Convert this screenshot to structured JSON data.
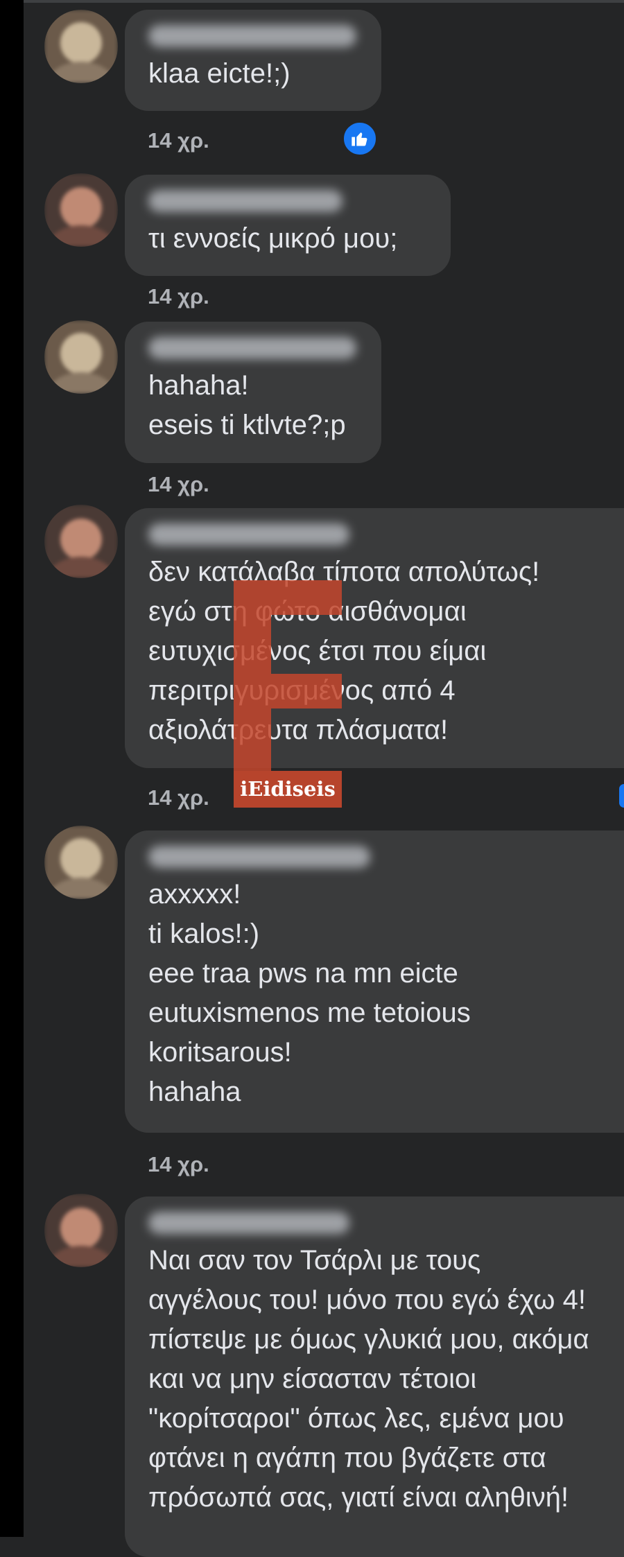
{
  "comments": [
    {
      "author_hidden": true,
      "lines": [
        "klaa eicte!;)"
      ],
      "time": "14 χρ.",
      "liked": true,
      "like_icon": "thumbs-up-icon",
      "avatar_colors": [
        "#6b5a4a",
        "#c9b79a"
      ]
    },
    {
      "author_hidden": true,
      "lines": [
        "τι εννοείς μικρό μου;"
      ],
      "time": "14 χρ.",
      "avatar_colors": [
        "#4a3a35",
        "#c08a74"
      ]
    },
    {
      "author_hidden": true,
      "lines": [
        "hahaha!",
        "eseis ti ktlvte?;p"
      ],
      "time": "14 χρ.",
      "avatar_colors": [
        "#6b5a4a",
        "#c9b79a"
      ]
    },
    {
      "author_hidden": true,
      "lines": [
        "δεν κατάλαβα τίποτα απολύτως!",
        "εγώ στη φώτο αισθάνομαι",
        "ευτυχισμένος έτσι που είμαι",
        "περιτριγυρισμένος από 4",
        "αξιολάτρευτα πλάσματα!"
      ],
      "time": "14 χρ.",
      "avatar_colors": [
        "#4a3a35",
        "#c08a74"
      ]
    },
    {
      "author_hidden": true,
      "lines": [
        "axxxxx!",
        "ti kalos!:)",
        "eee traa pws na mn eicte",
        "eutuxismenos me tetoious",
        "koritsarous!",
        "hahaha"
      ],
      "time": "14 χρ.",
      "avatar_colors": [
        "#6b5a4a",
        "#c9b79a"
      ]
    },
    {
      "author_hidden": true,
      "lines": [
        "Ναι σαν τον Τσάρλι με τους",
        "αγγέλους του! μόνο που εγώ έχω 4!",
        "πίστεψε με όμως γλυκιά μου, ακόμα",
        "και να μην είσασταν τέτοιοι",
        "\"κορίτσαροι\" όπως λες, εμένα μου",
        "φτάνει η αγάπη που βγάζετε στα",
        "πρόσωπά σας, γιατί είναι αληθινή!"
      ],
      "time": "",
      "avatar_colors": [
        "#4a3a35",
        "#c08a74"
      ]
    }
  ],
  "watermark": {
    "label": "iEidiseis",
    "color": "#c4462d"
  },
  "colors": {
    "background": "#242526",
    "bubble": "#3a3b3c",
    "text": "#e4e6eb",
    "meta": "#b0b3b8",
    "like": "#1877f2"
  }
}
